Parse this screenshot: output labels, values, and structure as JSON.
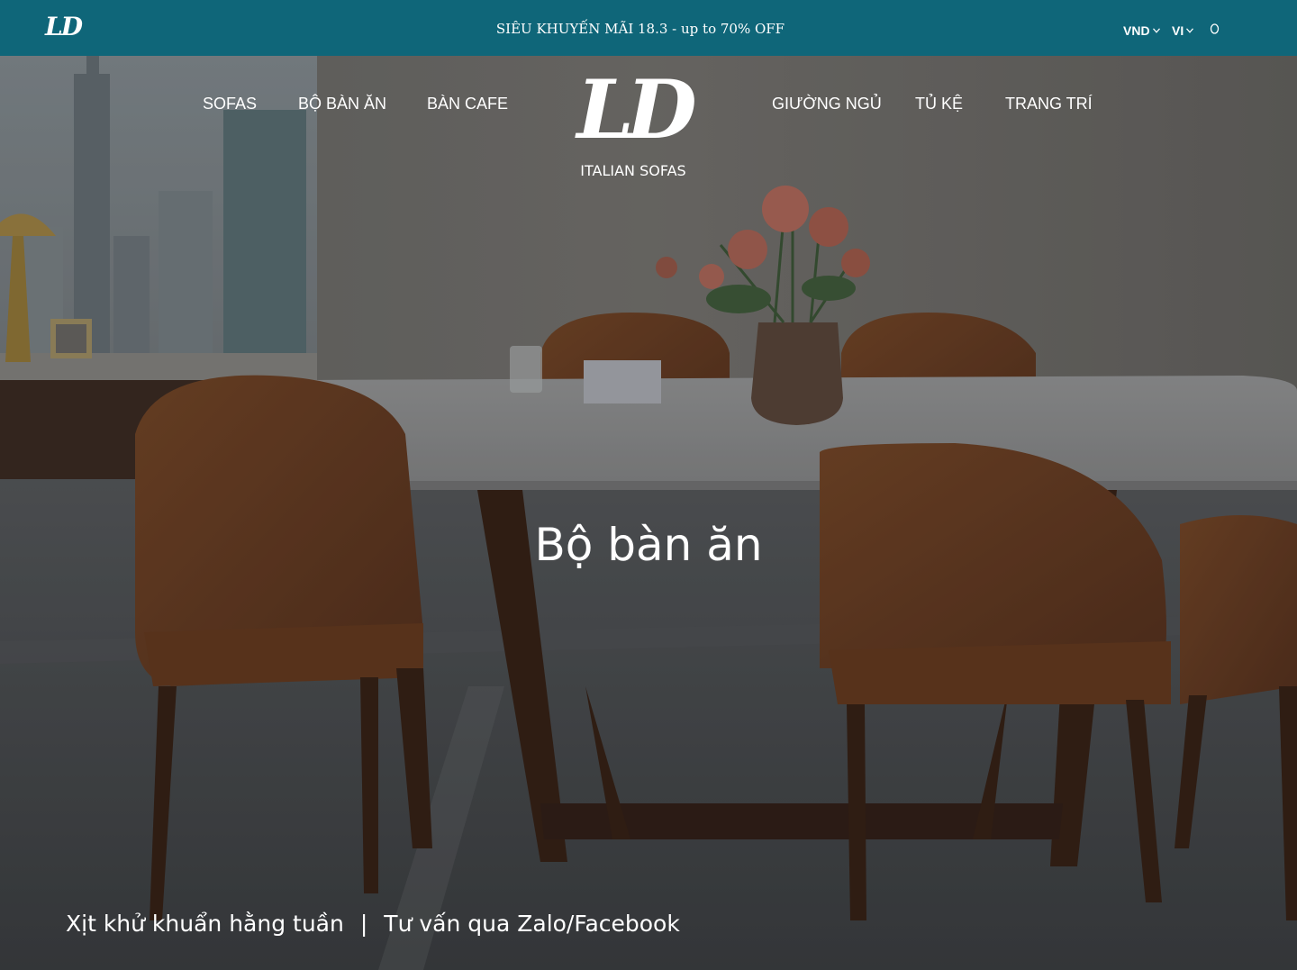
{
  "topbar": {
    "mini_logo": "LD",
    "promo": "SIÊU KHUYẾN MÃI 18.3 - up to 70% OFF",
    "currency": "VND",
    "language": "VI",
    "search_icon": "search-icon"
  },
  "nav": {
    "left": [
      "SOFAS",
      "BỘ BÀN ĂN",
      "BÀN CAFE"
    ],
    "right": [
      "GIƯỜNG NGỦ",
      "TỦ KỆ",
      "TRANG TRÍ"
    ]
  },
  "brand": {
    "mark": "LD",
    "subtitle": "ITALIAN SOFAS"
  },
  "hero": {
    "title": "Bộ bàn ăn"
  },
  "bottom": {
    "left": "Xịt khử khuẩn hằng tuần",
    "separator": "|",
    "right": "Tư vấn qua Zalo/Facebook"
  },
  "colors": {
    "topbar": "#0f6679",
    "text": "#ffffff"
  }
}
